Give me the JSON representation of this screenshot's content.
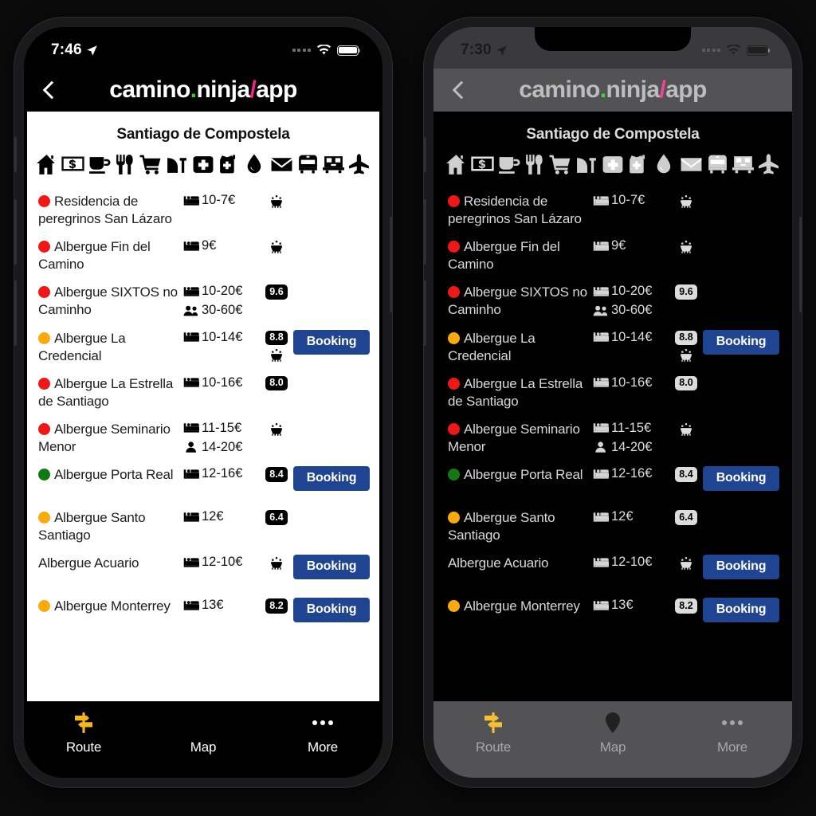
{
  "app": {
    "brand_prefix": "camino",
    "brand_dot": ".",
    "brand_middle": "ninja",
    "brand_slash": "/",
    "brand_suffix": "app",
    "back_icon": "chevron-left-icon"
  },
  "phones": [
    {
      "theme": "light",
      "status": {
        "time": "7:46",
        "location_icon": "location-arrow-icon",
        "wifi_icon": "wifi-icon",
        "battery_icon": "battery-icon"
      }
    },
    {
      "theme": "dark",
      "status": {
        "time": "7:30",
        "location_icon": "location-arrow-icon",
        "wifi_icon": "wifi-icon",
        "battery_icon": "battery-icon"
      }
    }
  ],
  "page": {
    "city": "Santiago de Compostela",
    "amenities": [
      {
        "name": "house-icon",
        "label": "Accommodation"
      },
      {
        "name": "atm-icon",
        "label": "ATM"
      },
      {
        "name": "coffee-icon",
        "label": "Cafe"
      },
      {
        "name": "restaurant-icon",
        "label": "Restaurant"
      },
      {
        "name": "shopping-cart-icon",
        "label": "Supermarket"
      },
      {
        "name": "laundry-icon",
        "label": "Laundry"
      },
      {
        "name": "pharmacy-icon",
        "label": "Pharmacy"
      },
      {
        "name": "medical-icon",
        "label": "Medical"
      },
      {
        "name": "water-drop-icon",
        "label": "Water"
      },
      {
        "name": "mail-icon",
        "label": "Post"
      },
      {
        "name": "bus-icon",
        "label": "Bus"
      },
      {
        "name": "train-icon",
        "label": "Train"
      },
      {
        "name": "plane-icon",
        "label": "Airport"
      }
    ]
  },
  "colors": {
    "pin_red": "#f01717",
    "pin_amber": "#fca90c",
    "pin_green": "#137a13",
    "booking_blue": "#1f4491",
    "brand_green": "#27d119",
    "brand_pink": "#f72585"
  },
  "listings": [
    {
      "name": "Residencia de peregrinos San Lázaro",
      "pin": "red",
      "prices": [
        {
          "icon": "bed-icon",
          "value": "10-7€"
        }
      ],
      "rating": null,
      "sheep": true,
      "booking": null
    },
    {
      "name": "Albergue Fin del Camino",
      "pin": "red",
      "prices": [
        {
          "icon": "bed-icon",
          "value": "9€"
        }
      ],
      "rating": null,
      "sheep": true,
      "booking": null
    },
    {
      "name": "Albergue SIXTOS no Caminho",
      "pin": "red",
      "prices": [
        {
          "icon": "bed-icon",
          "value": "10-20€"
        },
        {
          "icon": "two-people-icon",
          "value": "30-60€"
        }
      ],
      "rating": "9.6",
      "sheep": false,
      "booking": null
    },
    {
      "name": "Albergue La Credencial",
      "pin": "amber",
      "prices": [
        {
          "icon": "bed-icon",
          "value": "10-14€"
        }
      ],
      "rating": "8.8",
      "sheep": true,
      "booking": "Booking"
    },
    {
      "name": "Albergue La Estrella de Santiago",
      "pin": "red",
      "prices": [
        {
          "icon": "bed-icon",
          "value": "10-16€"
        }
      ],
      "rating": "8.0",
      "sheep": false,
      "booking": null
    },
    {
      "name": "Albergue Seminario Menor",
      "pin": "red",
      "prices": [
        {
          "icon": "bed-icon",
          "value": "11-15€"
        },
        {
          "icon": "person-icon",
          "value": "14-20€"
        }
      ],
      "rating": null,
      "sheep": true,
      "booking": null
    },
    {
      "name": "Albergue Porta Real",
      "pin": "green",
      "prices": [
        {
          "icon": "bed-icon",
          "value": "12-16€"
        }
      ],
      "rating": "8.4",
      "sheep": false,
      "booking": "Booking"
    },
    {
      "name": "Albergue Santo Santiago",
      "pin": "amber",
      "prices": [
        {
          "icon": "bed-icon",
          "value": "12€"
        }
      ],
      "rating": "6.4",
      "sheep": false,
      "booking": null
    },
    {
      "name": "Albergue Acuario",
      "pin": "none",
      "prices": [
        {
          "icon": "bed-icon",
          "value": "12-10€"
        }
      ],
      "rating": null,
      "sheep": true,
      "booking": "Booking"
    },
    {
      "name": "Albergue Monterrey",
      "pin": "amber",
      "prices": [
        {
          "icon": "bed-icon",
          "value": "13€"
        }
      ],
      "rating": "8.2",
      "sheep": false,
      "booking": "Booking"
    }
  ],
  "tabs": [
    {
      "label": "Route",
      "icon": "signpost-icon",
      "active": true
    },
    {
      "label": "Map",
      "icon": "map-pin-icon",
      "active": false
    },
    {
      "label": "More",
      "icon": "ellipsis-icon",
      "active": false
    }
  ]
}
